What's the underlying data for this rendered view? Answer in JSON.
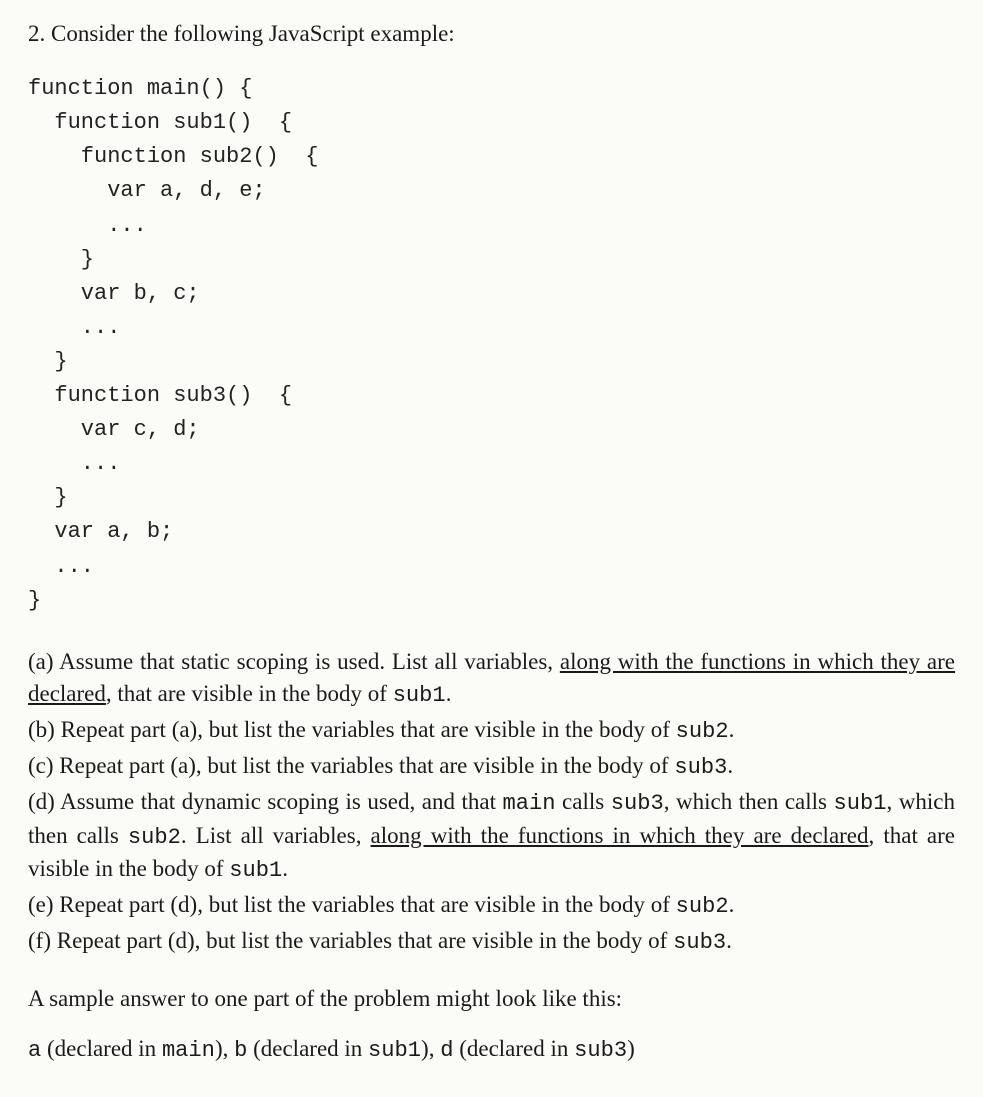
{
  "question_number": "2.",
  "intro": "Consider the following JavaScript example:",
  "code": "function main() {\n  function sub1()  {\n    function sub2()  {\n      var a, d, e;\n      ...\n    }\n    var b, c;\n    ...\n  }\n  function sub3()  {\n    var c, d;\n    ...\n  }\n  var a, b;\n  ...\n}",
  "parts": {
    "a": {
      "label": "(a)",
      "t1": "Assume that static scoping is used. List all variables, ",
      "u1": "along with the functions in which they are declared",
      "t2": ", that are visible in the body of ",
      "c1": "sub1",
      "t3": "."
    },
    "b": {
      "label": "(b)",
      "t1": "Repeat part (a), but list the variables that are visible in the body of ",
      "c1": "sub2",
      "t2": "."
    },
    "c": {
      "label": "(c)",
      "t1": "Repeat part (a), but list the variables that are visible in the body of ",
      "c1": "sub3",
      "t2": "."
    },
    "d": {
      "label": "(d)",
      "t1": "Assume that dynamic scoping is used, and that ",
      "c1": "main",
      "t2": " calls ",
      "c2": "sub3",
      "t3": ", which then calls ",
      "c3": "sub1",
      "t4": ", which then calls ",
      "c4": "sub2",
      "t5": ". List all variables, ",
      "u1": "along with the functions in which they are declared",
      "t6": ", that are visible in the body of ",
      "c5": "sub1",
      "t7": "."
    },
    "e": {
      "label": "(e)",
      "t1": "Repeat part (d), but list the variables that are visible in the body of ",
      "c1": "sub2",
      "t2": "."
    },
    "f": {
      "label": "(f)",
      "t1": "Repeat part (d), but list the variables that are visible in the body of ",
      "c1": "sub3",
      "t2": "."
    }
  },
  "sample_intro": "A sample answer to one part of the problem might look like this:",
  "sample": {
    "s1": "a",
    "p1": " (declared in ",
    "c1": "main",
    "p2": "), ",
    "s2": "b",
    "p3": " (declared in ",
    "c2": "sub1",
    "p4": "), ",
    "s3": "d",
    "p5": " (declared in ",
    "c3": "sub3",
    "p6": ")"
  }
}
